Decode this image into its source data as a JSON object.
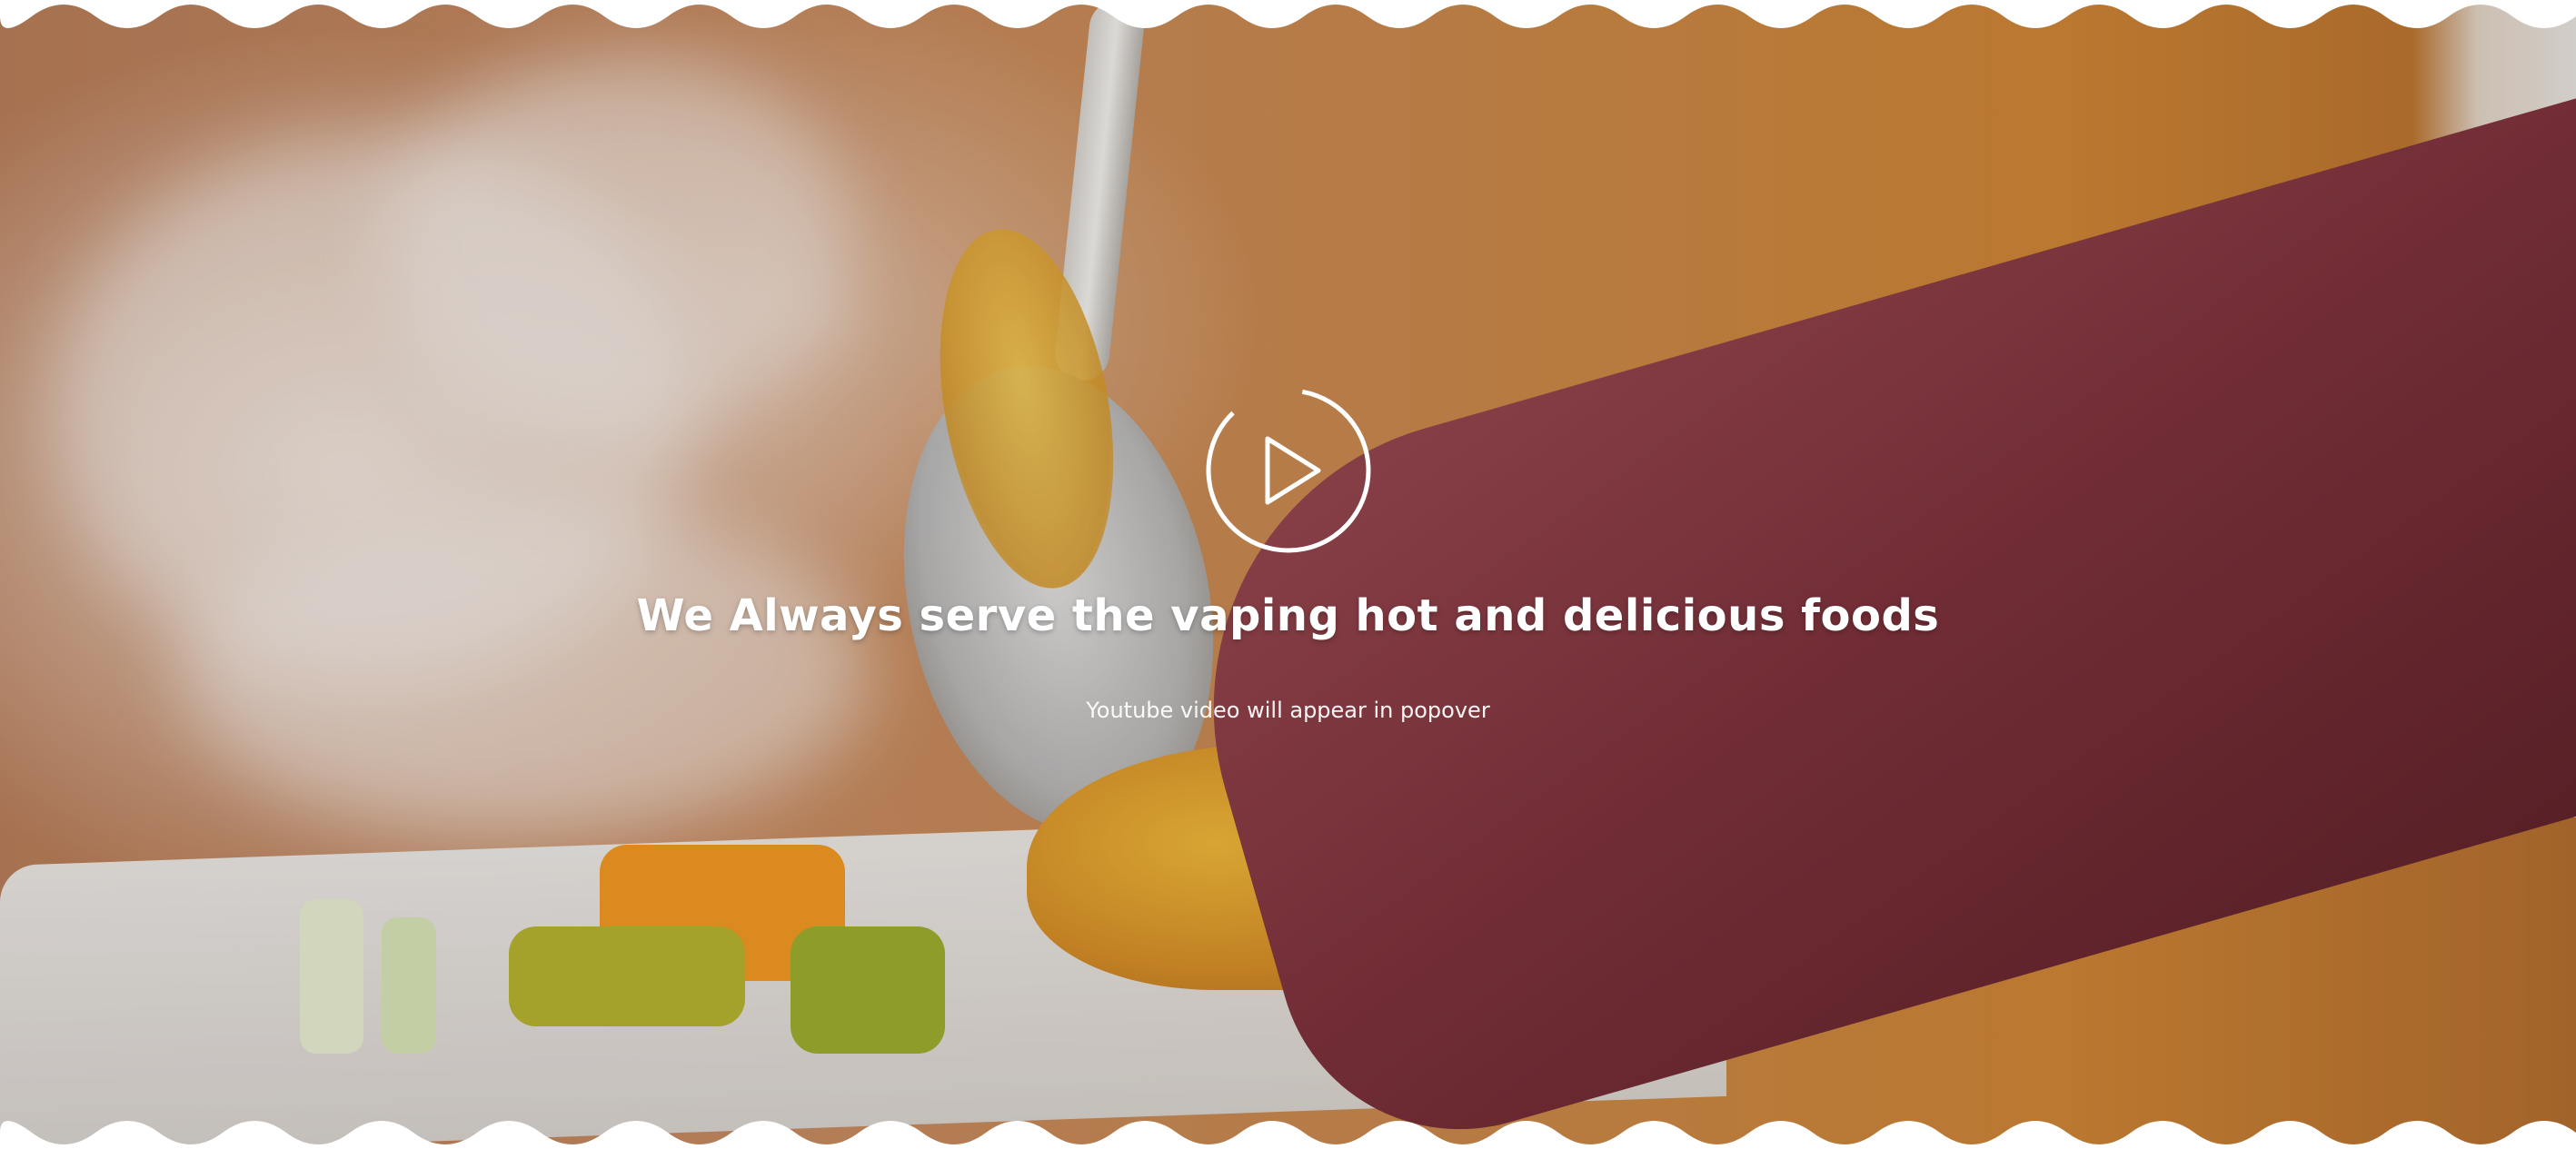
{
  "video_banner": {
    "headline": "We Always serve the vaping hot and delicious foods",
    "note": "Youtube video will appear in popover",
    "play_icon": "play-icon",
    "colors": {
      "text": "#ffffff",
      "play_ring": "#ffffff",
      "background_warm": "#cb8a4d",
      "edge": "#ffffff"
    }
  }
}
